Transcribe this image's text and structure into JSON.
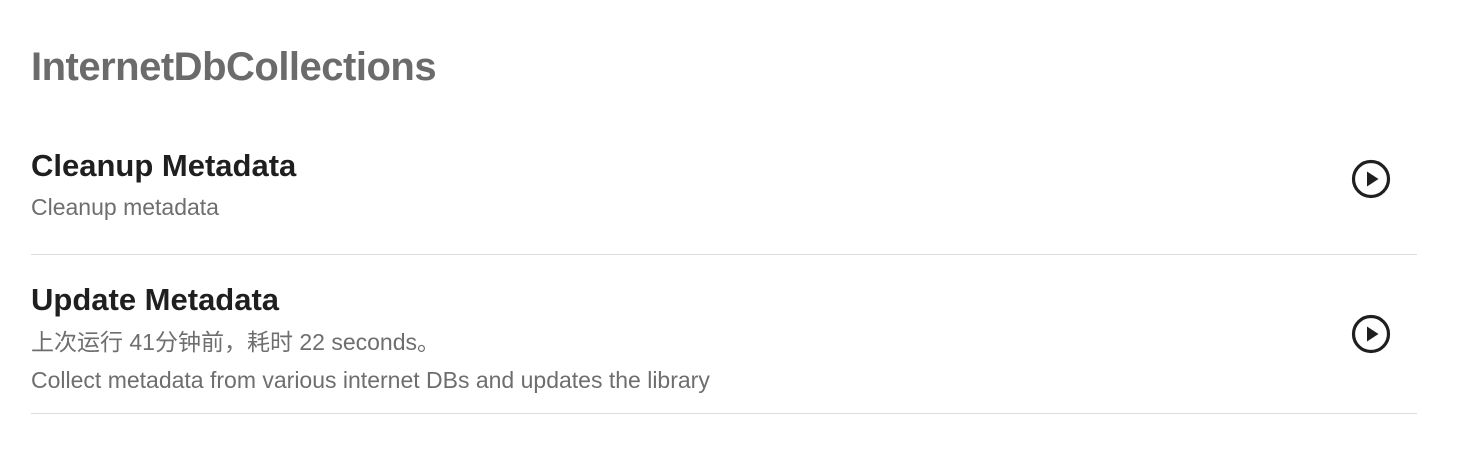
{
  "section": {
    "title": "InternetDbCollections"
  },
  "tasks": [
    {
      "name": "Cleanup Metadata",
      "description": "Cleanup metadata",
      "action_icon": "play-circle-icon"
    },
    {
      "name": "Update Metadata",
      "last_run": "上次运行 41分钟前，耗时 22 seconds。",
      "description": "Collect metadata from various internet DBs and updates the library",
      "action_icon": "play-circle-icon"
    }
  ],
  "colors": {
    "title": "#6b6b6b",
    "text_primary": "#1f1f1f",
    "text_secondary": "#6e6e6e",
    "divider": "#dcdcdc"
  }
}
